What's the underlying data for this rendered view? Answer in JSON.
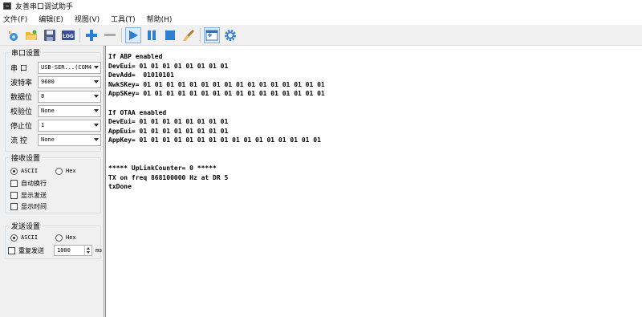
{
  "window": {
    "title": "友善串口调试助手"
  },
  "menu": [
    "文件(F)",
    "编辑(E)",
    "视图(V)",
    "工具(T)",
    "帮助(H)"
  ],
  "toolbar": {
    "icons": [
      "new-icon",
      "open-folder-icon",
      "save-icon",
      "log-icon",
      "add-icon",
      "remove-icon",
      "play-icon",
      "pause-icon",
      "stop-icon",
      "clear-brush-icon",
      "layout-window-icon",
      "gear-icon"
    ],
    "log_label": "LOG",
    "accent": "#2a7fd4"
  },
  "serial_settings": {
    "title": "串口设置",
    "port_label": "串  口",
    "port_value": "USB-SER...(COM4",
    "baud_label": "波特率",
    "baud_value": "9600",
    "databits_label": "数据位",
    "databits_value": "8",
    "parity_label": "校验位",
    "parity_value": "None",
    "stopbits_label": "停止位",
    "stopbits_value": "1",
    "flow_label": "流  控",
    "flow_value": "None"
  },
  "receive_settings": {
    "title": "接收设置",
    "ascii_label": "ASCII",
    "hex_label": "Hex",
    "ascii_selected": true,
    "auto_newline_label": "自动换行",
    "show_send_label": "显示发送",
    "show_time_label": "显示时间"
  },
  "send_settings": {
    "title": "发送设置",
    "ascii_label": "ASCII",
    "hex_label": "Hex",
    "ascii_selected": true,
    "repeat_label": "重复发送",
    "interval_value": "1000",
    "interval_unit": "ms"
  },
  "console": {
    "text": "If ABP enabled\nDevEui= 01 01 01 01 01 01 01 01\nDevAdd=  01010101\nNwkSKey= 01 01 01 01 01 01 01 01 01 01 01 01 01 01 01 01\nAppSKey= 01 01 01 01 01 01 01 01 01 01 01 01 01 01 01 01\n\nIf OTAA enabled\nDevEui= 01 01 01 01 01 01 01 01\nAppEui= 01 01 01 01 01 01 01 01\nAppKey= 01 01 01 01 01 01 01 01 01 01 01 01 01 01 01 01\n\n\n***** UpLinkCounter= 0 *****\nTX on freq 868100000 Hz at DR 5\ntxDone"
  }
}
